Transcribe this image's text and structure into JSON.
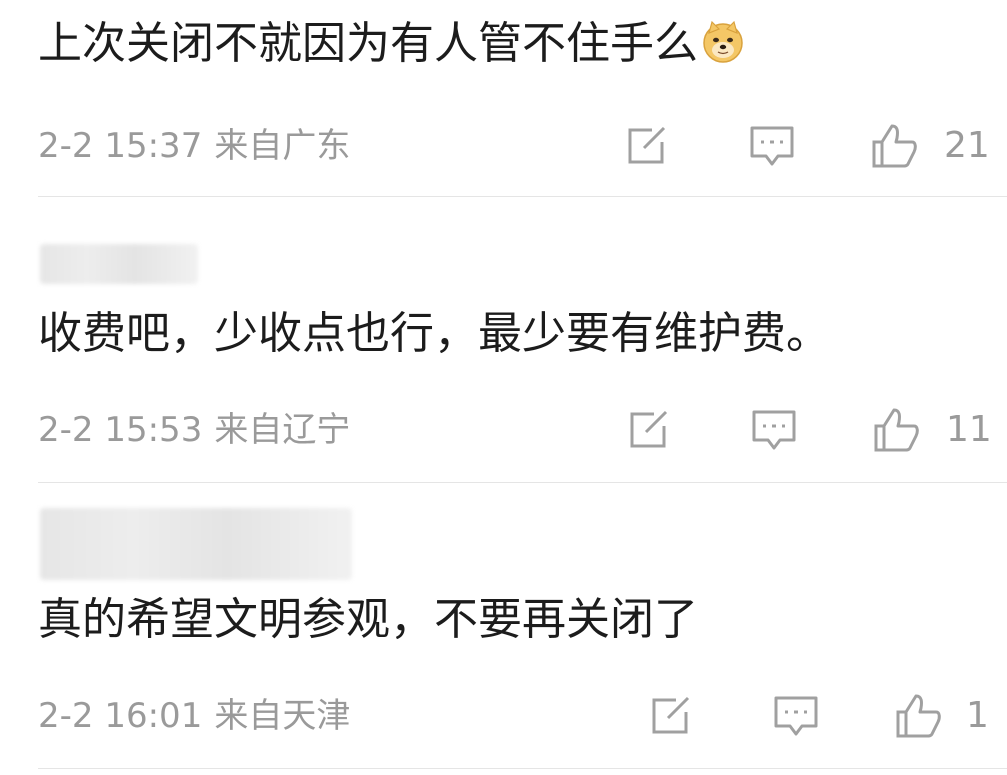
{
  "comments": [
    {
      "text": "上次关闭不就因为有人管不住手么",
      "emoji": "doge-emoji",
      "time": "2-2 15:37",
      "location": "来自广东",
      "likes": "21"
    },
    {
      "text": "收费吧，少收点也行，最少要有维护费。",
      "time": "2-2 15:53",
      "location": "来自辽宁",
      "likes": "11"
    },
    {
      "text": "真的希望文明参观，不要再关闭了",
      "time": "2-2 16:01",
      "location": "来自天津",
      "likes": "1"
    }
  ],
  "colors": {
    "text": "#1c1c1c",
    "meta": "#9a9a9a",
    "icon": "#a0a0a0",
    "divider": "#e5e5e5"
  },
  "icons": [
    "share-icon",
    "reply-icon",
    "like-icon"
  ]
}
